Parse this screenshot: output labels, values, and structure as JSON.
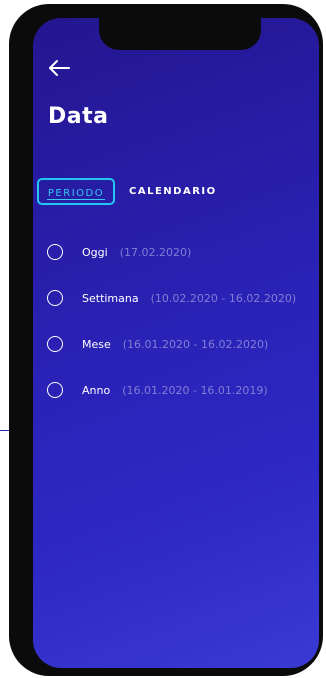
{
  "header": {
    "back_icon": "arrow-left-icon",
    "title": "Data"
  },
  "tabs": [
    {
      "label": "PERIODO",
      "selected": true
    },
    {
      "label": "CALENDARIO",
      "selected": false
    }
  ],
  "options": [
    {
      "label": "Oggi",
      "range": "(17.02.2020)",
      "selected": false
    },
    {
      "label": "Settimana",
      "range": "(10.02.2020 - 16.02.2020)",
      "selected": false
    },
    {
      "label": "Mese",
      "range": "(16.01.2020 - 16.02.2020)",
      "selected": false
    },
    {
      "label": "Anno",
      "range": "(16.01.2020 - 16.01.2019)",
      "selected": false
    }
  ],
  "colors": {
    "background_start": "#23168f",
    "background_end": "#3a3ad4",
    "accent": "#23c6f0",
    "range_text": "#7f7fd6"
  }
}
